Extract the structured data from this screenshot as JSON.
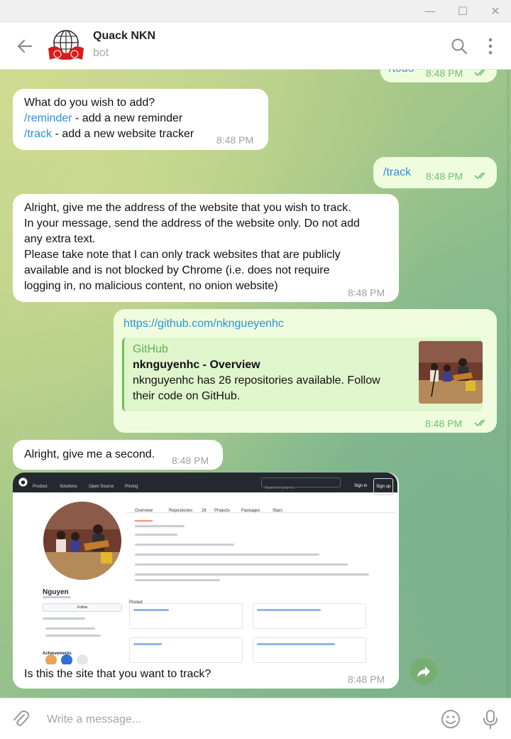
{
  "window": {
    "minimize_glyph": "—",
    "maximize_glyph": "☐",
    "close_glyph": "✕"
  },
  "header": {
    "title": "Quack NKN",
    "subtitle": "bot",
    "icons": [
      "back-arrow-icon",
      "bot-avatar",
      "search-icon",
      "more-vertical-icon"
    ]
  },
  "messages": {
    "partial_top": {
      "text": "/todo",
      "time": "8:48 PM"
    },
    "m1": {
      "line1": "What do you wish to add?",
      "cmd1": "/reminder",
      "rest1": " - add a new reminder",
      "cmd2": "/track",
      "rest2": " - add a new website tracker",
      "time": "8:48 PM"
    },
    "m2": {
      "text": "/track",
      "time": "8:48 PM"
    },
    "m3": {
      "line1": "Alright, give me the address of the website that you wish to track.",
      "line2": "In your message, send the address of the website only. Do not add",
      "line3": "any extra text.",
      "line4": "Please take note that I can only track websites that are publicly",
      "line5": "available and is not blocked by Chrome (i.e. does not require",
      "line6": "logging in, no malicious content, no onion website)",
      "time": "8:48 PM"
    },
    "m4": {
      "url": "https://github.com/nkngueyenhc",
      "preview_site": "GitHub",
      "preview_title": "nknguyenhc - Overview",
      "preview_desc": "nknguyenhc has 26 repositories available. Follow their code on GitHub.",
      "time": "8:48 PM"
    },
    "m5": {
      "text": "Alright, give me a second.",
      "time": "8:48 PM"
    },
    "m6": {
      "caption": "Is this the site that you want to track?",
      "time": "8:48 PM",
      "shot": {
        "nav": [
          "Product",
          "Solutions",
          "Open Source",
          "Pricing"
        ],
        "search": "Search or jump to...",
        "signin": "Sign in",
        "signup": "Sign up",
        "tabs": [
          "Overview",
          "Repositories",
          "Projects",
          "Packages",
          "Stars"
        ],
        "repo_count": "26",
        "profile_name": "Nguyen",
        "follow": "Follow",
        "pinned": "Pinned",
        "achievements": "Achievements"
      }
    }
  },
  "footer": {
    "placeholder": "Write a message...",
    "icons": [
      "attach-icon",
      "emoji-icon",
      "microphone-icon"
    ]
  },
  "colors": {
    "link": "#2e8fd4",
    "outgoing_bubble": "#effdde",
    "incoming_bubble": "#ffffff",
    "read_check": "#6fbf6b"
  }
}
